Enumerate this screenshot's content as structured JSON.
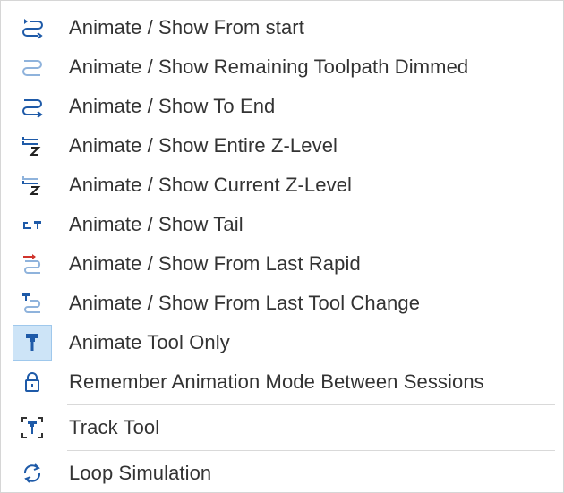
{
  "menu": {
    "items": [
      {
        "label": "Animate / Show From start",
        "icon": "animate-from-start-icon"
      },
      {
        "label": "Animate / Show Remaining Toolpath Dimmed",
        "icon": "remaining-dimmed-icon"
      },
      {
        "label": "Animate / Show To End",
        "icon": "animate-to-end-icon"
      },
      {
        "label": "Animate / Show Entire Z-Level",
        "icon": "entire-z-level-icon"
      },
      {
        "label": "Animate / Show Current Z-Level",
        "icon": "current-z-level-icon"
      },
      {
        "label": "Animate / Show Tail",
        "icon": "tail-icon"
      },
      {
        "label": "Animate / Show From Last Rapid",
        "icon": "last-rapid-icon"
      },
      {
        "label": "Animate / Show From Last Tool Change",
        "icon": "last-tool-change-icon"
      },
      {
        "label": "Animate Tool Only",
        "icon": "tool-only-icon",
        "checked": true
      },
      {
        "label": "Remember Animation Mode Between Sessions",
        "icon": "lock-icon"
      },
      {
        "label": "Track Tool",
        "icon": "track-tool-icon"
      },
      {
        "label": "Loop Simulation",
        "icon": "loop-icon"
      }
    ]
  },
  "colors": {
    "accent_blue": "#1e5aa8",
    "light_blue": "#8fb3dc",
    "rapid_red": "#d0342c",
    "checked_bg": "#cde4f7"
  }
}
